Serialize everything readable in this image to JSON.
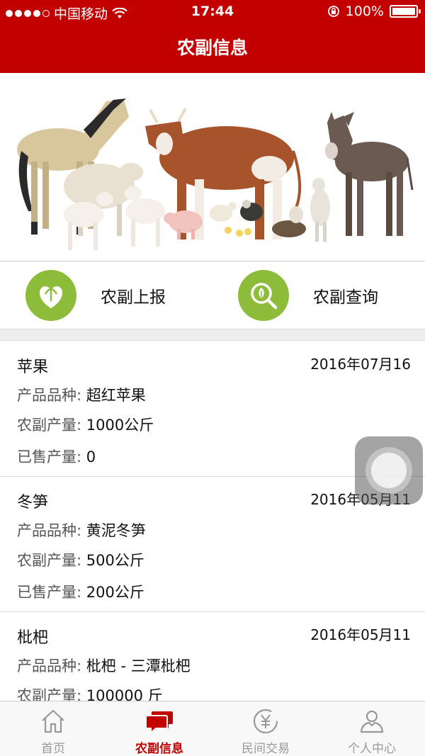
{
  "status": {
    "carrier": "中国移动",
    "time": "17:44",
    "battery": "100%"
  },
  "header": {
    "title": "农副信息"
  },
  "actions": {
    "report_label": "农副上报",
    "query_label": "农副查询"
  },
  "labels": {
    "variety": "产品品种: ",
    "output": "农副产量: ",
    "sold": "已售产量: "
  },
  "items": [
    {
      "name": "苹果",
      "date": "2016年07月16",
      "variety": "超红苹果",
      "output": "1000公斤",
      "sold": "0"
    },
    {
      "name": "冬笋",
      "date": "2016年05月11",
      "variety": "黄泥冬笋",
      "output": "500公斤",
      "sold": "200公斤"
    },
    {
      "name": "枇杷",
      "date": "2016年05月11",
      "variety": "枇杷 - 三潭枇杷",
      "output": "100000 斤",
      "sold": ""
    }
  ],
  "tabs": [
    {
      "label": "首页",
      "icon": "home-icon",
      "active": false
    },
    {
      "label": "农副信息",
      "icon": "chat-bubbles-icon",
      "active": true
    },
    {
      "label": "民间交易",
      "icon": "yen-coin-icon",
      "active": false
    },
    {
      "label": "个人中心",
      "icon": "person-icon",
      "active": false
    }
  ],
  "colors": {
    "brand": "#c30000",
    "action_icon": "#8dbb3a",
    "tab_inactive": "#999999"
  }
}
